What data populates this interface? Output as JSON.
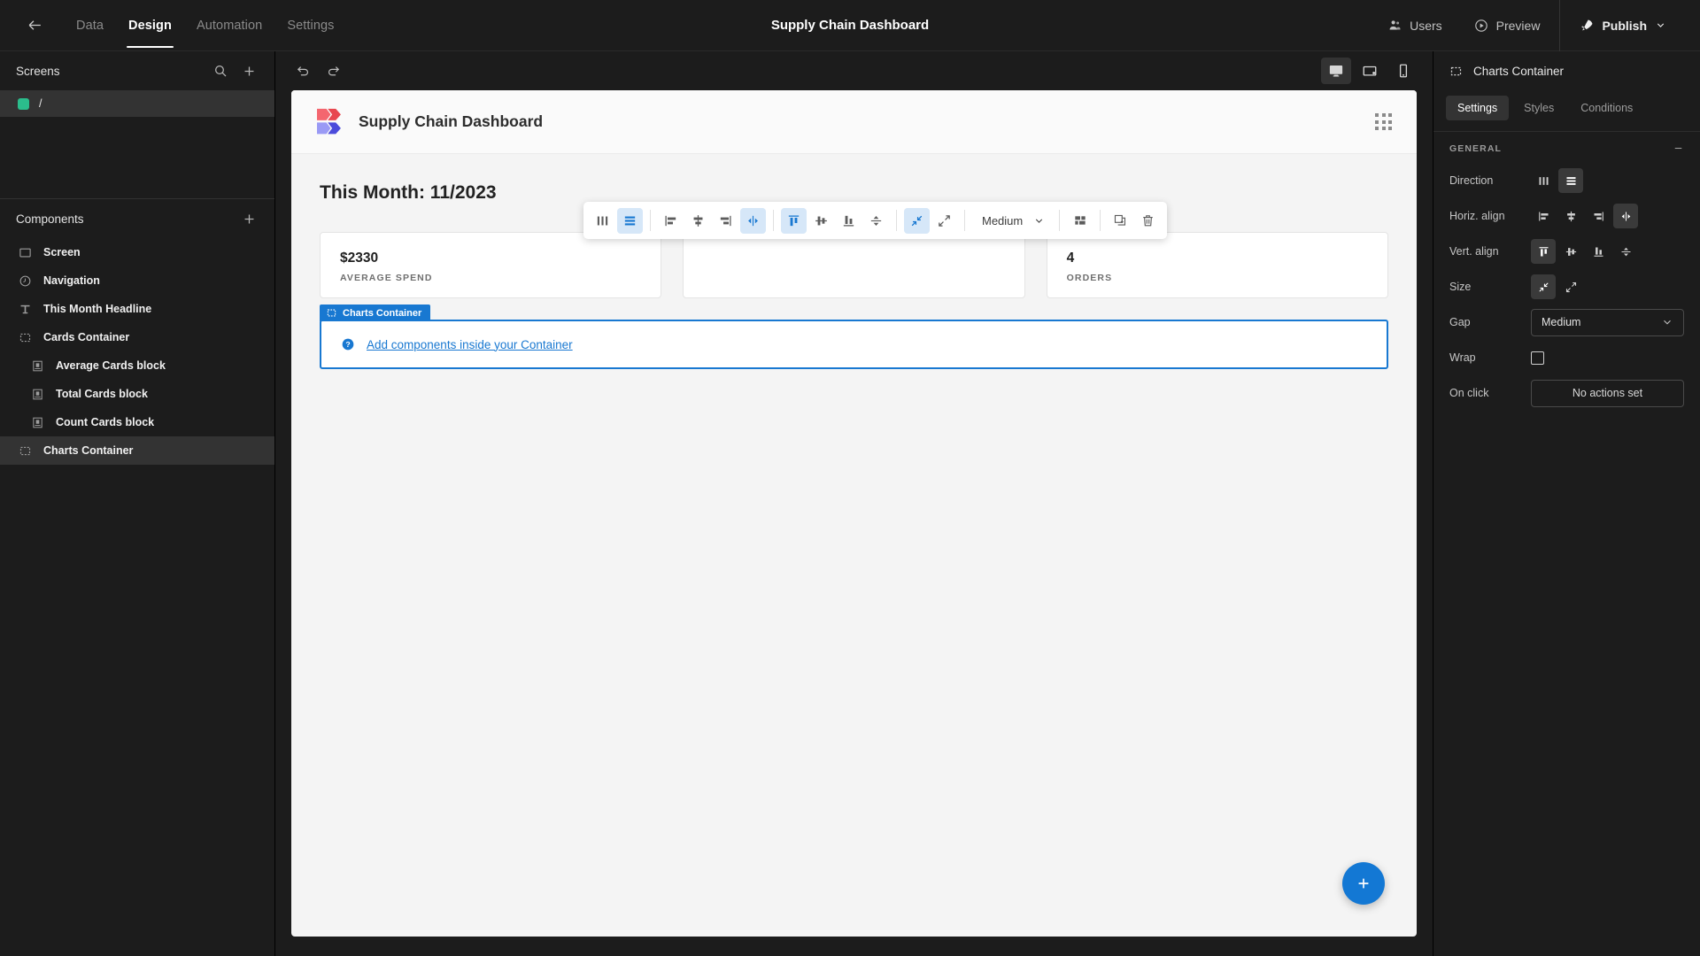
{
  "topbar": {
    "back_icon": "arrow-left-icon",
    "tabs": [
      {
        "label": "Data",
        "active": false
      },
      {
        "label": "Design",
        "active": true
      },
      {
        "label": "Automation",
        "active": false
      },
      {
        "label": "Settings",
        "active": false
      }
    ],
    "title": "Supply Chain Dashboard",
    "users_label": "Users",
    "preview_label": "Preview",
    "publish_label": "Publish"
  },
  "sidebar": {
    "screens_title": "Screens",
    "search_icon": "search-icon",
    "add_icon": "plus-icon",
    "screens": [
      {
        "label": "/",
        "color": "#2bbd8c",
        "selected": true
      }
    ],
    "components_title": "Components",
    "components_add_icon": "plus-icon",
    "components": [
      {
        "label": "Screen",
        "icon": "screen-icon",
        "indent": false,
        "selected": false
      },
      {
        "label": "Navigation",
        "icon": "navigation-icon",
        "indent": false,
        "selected": false
      },
      {
        "label": "This Month Headline",
        "icon": "text-icon",
        "indent": false,
        "selected": false
      },
      {
        "label": "Cards Container",
        "icon": "container-icon",
        "indent": false,
        "selected": false
      },
      {
        "label": "Average Cards block",
        "icon": "block-icon",
        "indent": true,
        "selected": false
      },
      {
        "label": "Total Cards block",
        "icon": "block-icon",
        "indent": true,
        "selected": false
      },
      {
        "label": "Count Cards block",
        "icon": "block-icon",
        "indent": true,
        "selected": false
      },
      {
        "label": "Charts Container",
        "icon": "container-icon",
        "indent": false,
        "selected": true
      }
    ]
  },
  "canvas_toolbar": {
    "undo_icon": "undo-icon",
    "redo_icon": "redo-icon",
    "devices": [
      {
        "name": "desktop-icon",
        "active": true
      },
      {
        "name": "tablet-icon",
        "active": false
      },
      {
        "name": "mobile-icon",
        "active": false
      }
    ]
  },
  "app": {
    "logo": {
      "name": "app-logo",
      "top_color": "#f4666f",
      "bottom_color": "#6b6bf0"
    },
    "title": "Supply Chain Dashboard",
    "grid_icon": "grid-dots-icon",
    "headline": "This Month: 11/2023",
    "cards": [
      {
        "value": "$2330",
        "label": "AVERAGE SPEND"
      },
      {
        "value": "",
        "label": ""
      },
      {
        "value": "4",
        "label": "ORDERS"
      }
    ],
    "charts_container": {
      "tag_label": "Charts Container",
      "tag_icon": "container-icon",
      "hint_icon": "help-icon",
      "hint_link": "Add components inside your Container",
      "accent": "#1878d1"
    },
    "fab_icon": "plus-icon"
  },
  "float_toolbar": {
    "groups": [
      {
        "buttons": [
          {
            "name": "direction-horizontal-icon",
            "active": false
          },
          {
            "name": "direction-vertical-icon",
            "active": true
          }
        ]
      },
      {
        "buttons": [
          {
            "name": "align-left-icon",
            "active": false
          },
          {
            "name": "align-center-icon",
            "active": false
          },
          {
            "name": "align-right-icon",
            "active": false
          },
          {
            "name": "align-space-between-icon",
            "active": true
          }
        ]
      },
      {
        "buttons": [
          {
            "name": "valign-top-icon",
            "active": true
          },
          {
            "name": "valign-middle-icon",
            "active": false
          },
          {
            "name": "valign-bottom-icon",
            "active": false
          },
          {
            "name": "valign-space-icon",
            "active": false
          }
        ]
      },
      {
        "buttons": [
          {
            "name": "size-shrink-icon",
            "active": true
          },
          {
            "name": "size-grow-icon",
            "active": false
          }
        ]
      }
    ],
    "gap_value": "Medium",
    "gap_chevron_icon": "chevron-down-icon",
    "layout_icon": "layout-icon",
    "duplicate_icon": "duplicate-icon",
    "delete_icon": "trash-icon"
  },
  "rightpanel": {
    "header_icon": "container-icon",
    "header_title": "Charts Container",
    "tabs": [
      {
        "label": "Settings",
        "active": true
      },
      {
        "label": "Styles",
        "active": false
      },
      {
        "label": "Conditions",
        "active": false
      }
    ],
    "section_title": "GENERAL",
    "collapse_icon": "minus-icon",
    "rows": {
      "direction": {
        "label": "Direction",
        "options": [
          {
            "name": "direction-horizontal-icon",
            "active": false
          },
          {
            "name": "direction-vertical-icon",
            "active": true
          }
        ]
      },
      "horiz_align": {
        "label": "Horiz. align",
        "options": [
          {
            "name": "align-left-icon",
            "active": false
          },
          {
            "name": "align-center-icon",
            "active": false
          },
          {
            "name": "align-right-icon",
            "active": false
          },
          {
            "name": "align-space-between-icon",
            "active": true
          }
        ]
      },
      "vert_align": {
        "label": "Vert. align",
        "options": [
          {
            "name": "valign-top-icon",
            "active": true
          },
          {
            "name": "valign-middle-icon",
            "active": false
          },
          {
            "name": "valign-bottom-icon",
            "active": false
          },
          {
            "name": "valign-space-icon",
            "active": false
          }
        ]
      },
      "size": {
        "label": "Size",
        "options": [
          {
            "name": "size-shrink-icon",
            "active": true
          },
          {
            "name": "size-grow-icon",
            "active": false
          }
        ]
      },
      "gap": {
        "label": "Gap",
        "value": "Medium",
        "chevron_icon": "chevron-down-icon"
      },
      "wrap": {
        "label": "Wrap",
        "checked": false
      },
      "on_click": {
        "label": "On click",
        "value": "No actions set"
      }
    }
  }
}
